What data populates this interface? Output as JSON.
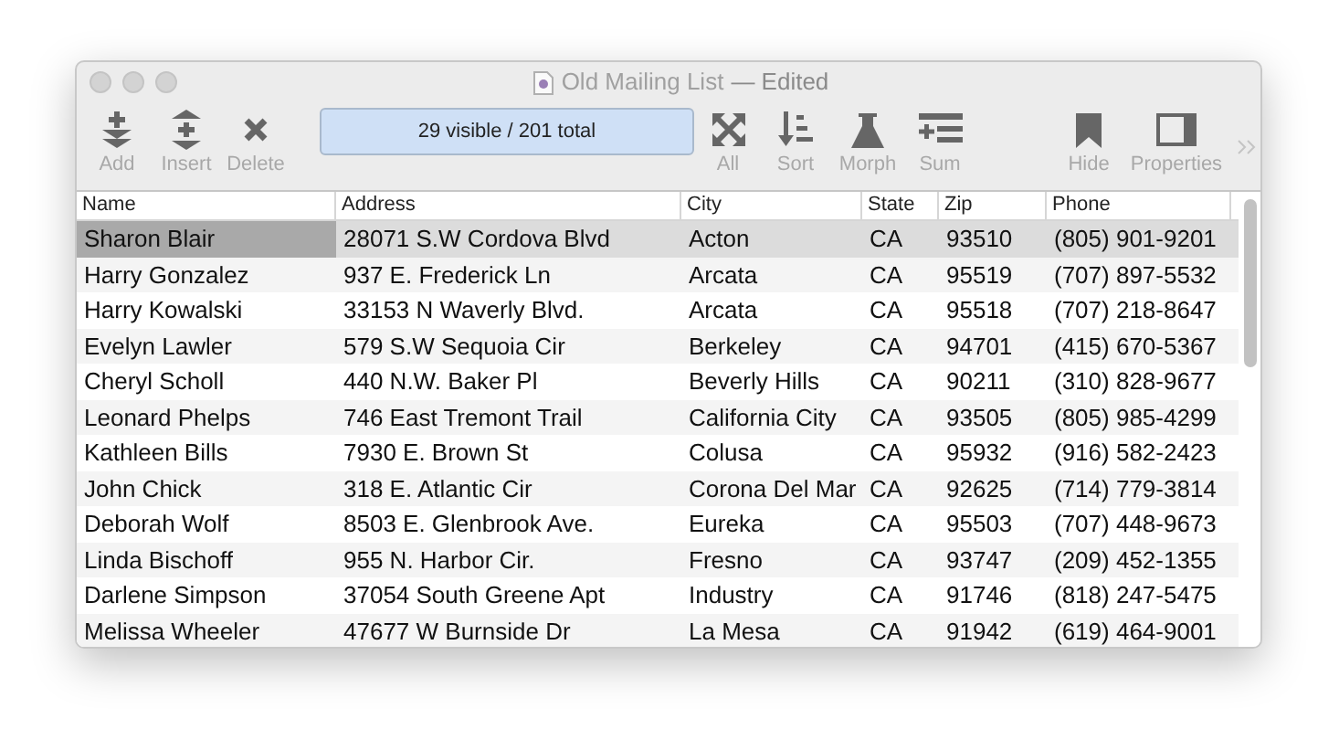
{
  "window": {
    "title": "Old Mailing List",
    "edited": "— Edited"
  },
  "toolbar": {
    "left": [
      {
        "kind": "add",
        "label": "Add"
      },
      {
        "kind": "insert",
        "label": "Insert"
      },
      {
        "kind": "delete",
        "label": "Delete"
      }
    ],
    "status": "29 visible / 201 total",
    "middle": [
      {
        "kind": "all",
        "label": "All"
      },
      {
        "kind": "sort",
        "label": "Sort"
      },
      {
        "kind": "morph",
        "label": "Morph"
      },
      {
        "kind": "sum",
        "label": "Sum"
      }
    ],
    "right": [
      {
        "kind": "hide",
        "label": "Hide"
      },
      {
        "kind": "properties",
        "label": "Properties"
      }
    ]
  },
  "table": {
    "columns": [
      "Name",
      "Address",
      "City",
      "State",
      "Zip",
      "Phone"
    ],
    "rows": [
      {
        "selected": true,
        "cells": [
          {
            "text": "Sharon Blair",
            "selected": true
          },
          {
            "text": "28071 S.W Cordova Blvd",
            "selected": false
          },
          {
            "text": "Acton",
            "selected": false
          },
          {
            "text": "CA",
            "selected": false
          },
          {
            "text": "93510",
            "selected": false
          },
          {
            "text": "(805) 901-9201",
            "selected": false
          }
        ]
      },
      {
        "selected": false,
        "cells": [
          {
            "text": "Harry Gonzalez",
            "selected": false
          },
          {
            "text": "937 E. Frederick Ln",
            "selected": false
          },
          {
            "text": "Arcata",
            "selected": false
          },
          {
            "text": "CA",
            "selected": false
          },
          {
            "text": "95519",
            "selected": false
          },
          {
            "text": "(707) 897-5532",
            "selected": false
          }
        ]
      },
      {
        "selected": false,
        "cells": [
          {
            "text": "Harry Kowalski",
            "selected": false
          },
          {
            "text": "33153 N Waverly Blvd.",
            "selected": false
          },
          {
            "text": "Arcata",
            "selected": false
          },
          {
            "text": "CA",
            "selected": false
          },
          {
            "text": "95518",
            "selected": false
          },
          {
            "text": "(707) 218-8647",
            "selected": false
          }
        ]
      },
      {
        "selected": false,
        "cells": [
          {
            "text": "Evelyn Lawler",
            "selected": false
          },
          {
            "text": "579 S.W Sequoia Cir",
            "selected": false
          },
          {
            "text": "Berkeley",
            "selected": false
          },
          {
            "text": "CA",
            "selected": false
          },
          {
            "text": "94701",
            "selected": false
          },
          {
            "text": "(415) 670-5367",
            "selected": false
          }
        ]
      },
      {
        "selected": false,
        "cells": [
          {
            "text": "Cheryl Scholl",
            "selected": false
          },
          {
            "text": "440 N.W. Baker Pl",
            "selected": false
          },
          {
            "text": "Beverly Hills",
            "selected": false
          },
          {
            "text": "CA",
            "selected": false
          },
          {
            "text": "90211",
            "selected": false
          },
          {
            "text": "(310) 828-9677",
            "selected": false
          }
        ]
      },
      {
        "selected": false,
        "cells": [
          {
            "text": "Leonard Phelps",
            "selected": false
          },
          {
            "text": "746 East Tremont Trail",
            "selected": false
          },
          {
            "text": "California City",
            "selected": false
          },
          {
            "text": "CA",
            "selected": false
          },
          {
            "text": "93505",
            "selected": false
          },
          {
            "text": "(805) 985-4299",
            "selected": false
          }
        ]
      },
      {
        "selected": false,
        "cells": [
          {
            "text": "Kathleen Bills",
            "selected": false
          },
          {
            "text": "7930 E. Brown St",
            "selected": false
          },
          {
            "text": "Colusa",
            "selected": false
          },
          {
            "text": "CA",
            "selected": false
          },
          {
            "text": "95932",
            "selected": false
          },
          {
            "text": "(916) 582-2423",
            "selected": false
          }
        ]
      },
      {
        "selected": false,
        "cells": [
          {
            "text": "John Chick",
            "selected": false
          },
          {
            "text": "318 E. Atlantic Cir",
            "selected": false
          },
          {
            "text": "Corona Del Mar",
            "selected": false
          },
          {
            "text": "CA",
            "selected": false
          },
          {
            "text": "92625",
            "selected": false
          },
          {
            "text": "(714) 779-3814",
            "selected": false
          }
        ]
      },
      {
        "selected": false,
        "cells": [
          {
            "text": "Deborah Wolf",
            "selected": false
          },
          {
            "text": "8503 E. Glenbrook Ave.",
            "selected": false
          },
          {
            "text": "Eureka",
            "selected": false
          },
          {
            "text": "CA",
            "selected": false
          },
          {
            "text": "95503",
            "selected": false
          },
          {
            "text": "(707) 448-9673",
            "selected": false
          }
        ]
      },
      {
        "selected": false,
        "cells": [
          {
            "text": "Linda Bischoff",
            "selected": false
          },
          {
            "text": "955 N. Harbor Cir.",
            "selected": false
          },
          {
            "text": "Fresno",
            "selected": false
          },
          {
            "text": "CA",
            "selected": false
          },
          {
            "text": "93747",
            "selected": false
          },
          {
            "text": "(209) 452-1355",
            "selected": false
          }
        ]
      },
      {
        "selected": false,
        "cells": [
          {
            "text": "Darlene Simpson",
            "selected": false
          },
          {
            "text": "37054 South Greene Apt",
            "selected": false
          },
          {
            "text": "Industry",
            "selected": false
          },
          {
            "text": "CA",
            "selected": false
          },
          {
            "text": "91746",
            "selected": false
          },
          {
            "text": "(818) 247-5475",
            "selected": false
          }
        ]
      },
      {
        "selected": false,
        "cells": [
          {
            "text": "Melissa Wheeler",
            "selected": false
          },
          {
            "text": "47677 W Burnside Dr",
            "selected": false
          },
          {
            "text": "La Mesa",
            "selected": false
          },
          {
            "text": "CA",
            "selected": false
          },
          {
            "text": "91942",
            "selected": false
          },
          {
            "text": "(619) 464-9001",
            "selected": false
          }
        ]
      }
    ]
  }
}
